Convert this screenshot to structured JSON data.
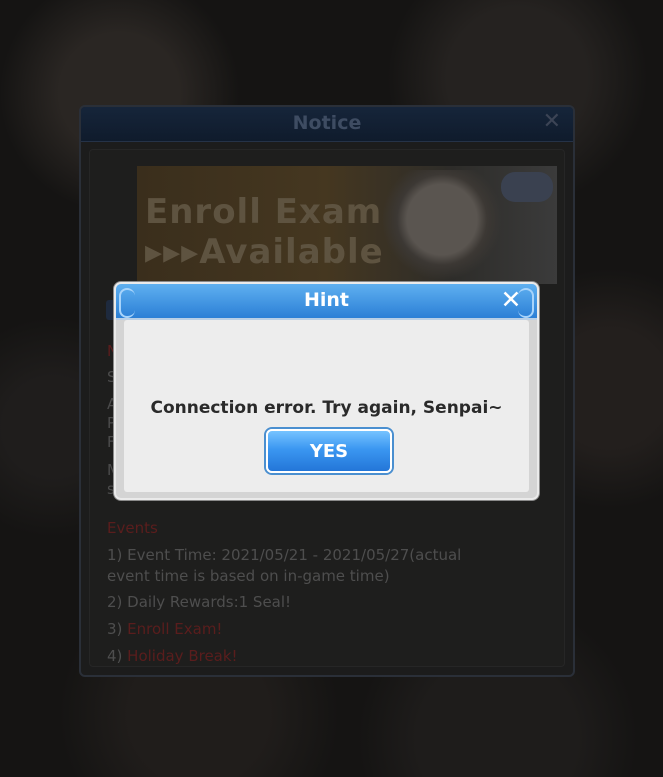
{
  "notice": {
    "title": "Notice",
    "close_glyph": "✕",
    "banner_line1": "Enroll Exam",
    "banner_line2": "▸▸▸Available",
    "peek_n": "N",
    "peek_s": "S",
    "peek_a": "A",
    "peek_p": "P",
    "peek_f": "F",
    "peek_m": "M",
    "peek_s2": "s",
    "events_heading": "Events",
    "event1": "1) Event Time: 2021/05/21 - 2021/05/27(actual event time is based on in-game time)",
    "event2": "2) Daily Rewards:1 Seal!",
    "event3_prefix": "3) ",
    "event3_link": "Enroll Exam!",
    "event4_prefix": "4) ",
    "event4_link": "Holiday Break!"
  },
  "hint": {
    "title": "Hint",
    "close_glyph": "✕",
    "message": "Connection error. Try again, Senpai~",
    "yes_label": "YES"
  },
  "colors": {
    "hint_header": "#3d95e6",
    "yes_button": "#3b97f1",
    "dim_red": "#5a1d1d"
  }
}
